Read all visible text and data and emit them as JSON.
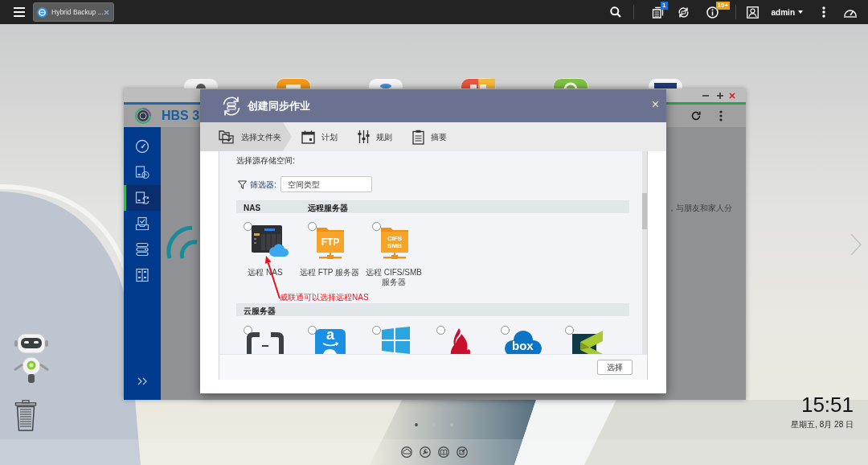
{
  "top_bar": {
    "tab": {
      "title": "Hybrid Backup ...",
      "selected": true
    },
    "notification_badge": "1",
    "info_badge": "10+",
    "user": "admin"
  },
  "hbs_window": {
    "title": "HBS 3",
    "sidebar": [
      {
        "kind": "gauge",
        "selected": false
      },
      {
        "kind": "backup",
        "selected": false
      },
      {
        "kind": "sync",
        "selected": true
      },
      {
        "kind": "restore",
        "selected": false
      },
      {
        "kind": "services",
        "selected": false
      },
      {
        "kind": "storage",
        "selected": false
      }
    ],
    "content_text": "，与朋友和家人分"
  },
  "dialog": {
    "title": "创建同步作业",
    "steps": [
      {
        "kind": "folders",
        "label": "选择文件夹",
        "selected": true
      },
      {
        "kind": "calendar",
        "label": "计划",
        "selected": false
      },
      {
        "kind": "sliders",
        "label": "规则",
        "selected": false
      },
      {
        "kind": "clipboard",
        "label": "摘要",
        "selected": false
      }
    ],
    "prompt": "选择源存储空间:",
    "filter": {
      "label": "筛选器:",
      "value": "空间类型"
    },
    "sections": [
      {
        "headers": [
          "NAS",
          "远程服务器"
        ],
        "items": [
          {
            "kind": "nas",
            "label": "远程 NAS",
            "selected": false
          },
          {
            "kind": "folder",
            "badge_lines": [
              "FTP"
            ],
            "label": "远程 FTP 服务器",
            "selected": false
          },
          {
            "kind": "folder",
            "badge_lines": [
              "CIFS",
              "SMB"
            ],
            "label": "远程 CIFS/SMB 服务器",
            "selected": false
          }
        ]
      },
      {
        "headers": [
          "云服务器"
        ],
        "items": [
          {
            "kind": "brackets",
            "selected": false
          },
          {
            "kind": "amazon",
            "badge": "a",
            "selected": false
          },
          {
            "kind": "windows",
            "selected": false
          },
          {
            "kind": "flame",
            "selected": false
          },
          {
            "kind": "box",
            "badge": "box",
            "selected": false
          },
          {
            "kind": "cube",
            "selected": false
          }
        ]
      }
    ],
    "button": "选择"
  },
  "annotation": {
    "text": "威联通可以选择远程NAS"
  },
  "desktop": {
    "page_dots": [
      {
        "selected": true
      },
      {
        "selected": false
      },
      {
        "selected": false
      }
    ],
    "time": "15:51",
    "date": "星期五, 8月 28 日"
  }
}
